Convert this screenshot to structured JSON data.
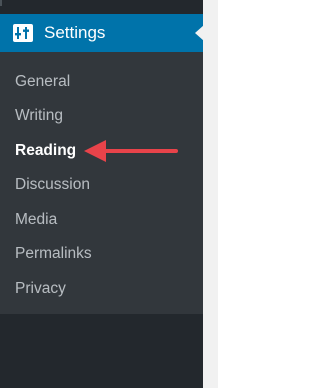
{
  "sidebar": {
    "header": {
      "icon": "settings-sliders-icon",
      "label": "Settings"
    },
    "items": [
      {
        "label": "General",
        "current": false
      },
      {
        "label": "Writing",
        "current": false
      },
      {
        "label": "Reading",
        "current": true
      },
      {
        "label": "Discussion",
        "current": false
      },
      {
        "label": "Media",
        "current": false
      },
      {
        "label": "Permalinks",
        "current": false
      },
      {
        "label": "Privacy",
        "current": false
      }
    ]
  },
  "annotation": {
    "arrow_color": "#e8434a",
    "points_to": "Reading"
  },
  "colors": {
    "header_bg": "#0073aa",
    "sidebar_bg": "#23282d",
    "submenu_bg": "#32373c"
  }
}
